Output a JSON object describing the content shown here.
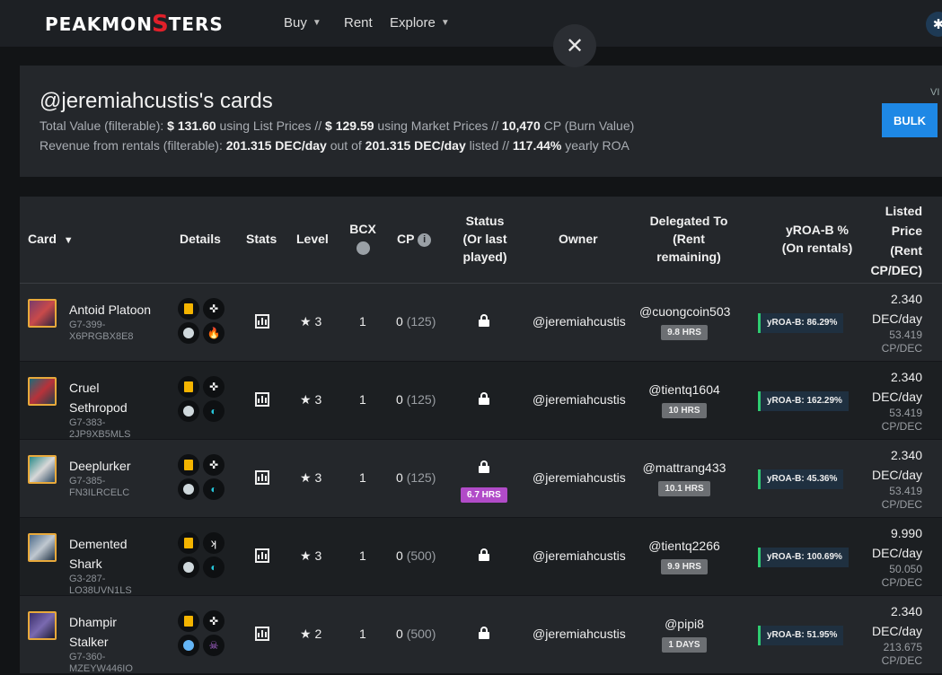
{
  "nav": {
    "logo_pre": "PEAKMON",
    "logo_s": "S",
    "logo_post": "TERS",
    "links": [
      {
        "label": "Buy",
        "has_dropdown": true
      },
      {
        "label": "Rent",
        "has_dropdown": false
      },
      {
        "label": "Explore",
        "has_dropdown": true
      }
    ],
    "close_glyph": "✕",
    "gear_glyph": "✱"
  },
  "summary": {
    "title": "@jeremiahcustis's cards",
    "total_label": "Total Value (filterable):",
    "total_list": "$ 131.60",
    "using_list": "using List Prices //",
    "total_market": "$ 129.59",
    "using_market": "using Market Prices //",
    "total_cp": "10,470",
    "cp_label": "CP (Burn Value)",
    "revenue_label": "Revenue from rentals (filterable):",
    "revenue_rate": "201.315 DEC/day",
    "out_of": "out of",
    "listed_rate": "201.315 DEC/day",
    "listed_label": "listed //",
    "roa": "117.44%",
    "roa_label": "yearly ROA",
    "bulk_label": "BULK",
    "vi_label": "VI"
  },
  "table": {
    "headers": {
      "card": "Card",
      "details": "Details",
      "stats": "Stats",
      "level": "Level",
      "bcx": "BCX",
      "cp": "CP",
      "status1": "Status",
      "status2": "(Or last",
      "status3": "played)",
      "owner": "Owner",
      "deleg1": "Delegated To",
      "deleg2": "(Rent",
      "deleg3": "remaining)",
      "yroa1": "yROA-B %",
      "yroa2": "(On rentals)",
      "price1": "Listed",
      "price2": "Price",
      "price3": "(Rent",
      "price4": "CP/DEC)"
    },
    "star_glyph": "★",
    "info_glyph": "i",
    "rows": [
      {
        "name_l1": "Antoid Platoon",
        "name_l2": "",
        "id1": "G7-399-",
        "id2": "X6PRGBX8E8",
        "level": "3",
        "bcx": "1",
        "cp": "0",
        "cp_max": "(125)",
        "status_badge": "",
        "owner": "@jeremiahcustis",
        "delegated": "@cuongcoin503",
        "remaining": "9.8 HRS",
        "yroa": "yROA-B: 86.29%",
        "price": "2.340",
        "price_unit": "DEC/day",
        "cpdec": "53.419",
        "cpdec_unit": "CP/DEC",
        "element_glyph": "🔥",
        "foil_glyph": "✜",
        "element_color": "#ff5a3c",
        "rarity_color": "#cfd8dc",
        "img_colors": [
          "#7a3b6b",
          "#c94a4a",
          "#2b2540"
        ]
      },
      {
        "name_l1": "Cruel",
        "name_l2": "Sethropod",
        "id1": "G7-383-",
        "id2": "2JP9XB5MLS",
        "level": "3",
        "bcx": "1",
        "cp": "0",
        "cp_max": "(125)",
        "status_badge": "",
        "owner": "@jeremiahcustis",
        "delegated": "@tientq1604",
        "remaining": "10 HRS",
        "yroa": "yROA-B: 162.29%",
        "price": "2.340",
        "price_unit": "DEC/day",
        "cpdec": "53.419",
        "cpdec_unit": "CP/DEC",
        "element_glyph": "◐",
        "foil_glyph": "✜",
        "element_color": "#26c6da",
        "rarity_color": "#cfd8dc",
        "img_colors": [
          "#1f6b78",
          "#b8323a",
          "#23404a"
        ]
      },
      {
        "name_l1": "Deeplurker",
        "name_l2": "",
        "id1": "G7-385-",
        "id2": "FN3ILRCELC",
        "level": "3",
        "bcx": "1",
        "cp": "0",
        "cp_max": "(125)",
        "status_badge": "6.7 HRS",
        "owner": "@jeremiahcustis",
        "delegated": "@mattrang433",
        "remaining": "10.1 HRS",
        "yroa": "yROA-B: 45.36%",
        "price": "2.340",
        "price_unit": "DEC/day",
        "cpdec": "53.419",
        "cpdec_unit": "CP/DEC",
        "element_glyph": "◐",
        "foil_glyph": "✜",
        "element_color": "#26c6da",
        "rarity_color": "#cfd8dc",
        "img_colors": [
          "#2a8b88",
          "#d8d8d8",
          "#2a4660"
        ]
      },
      {
        "name_l1": "Demented",
        "name_l2": "Shark",
        "id1": "G3-287-",
        "id2": "LO38UVN1LS",
        "level": "3",
        "bcx": "1",
        "cp": "0",
        "cp_max": "(500)",
        "status_badge": "",
        "owner": "@jeremiahcustis",
        "delegated": "@tientq2266",
        "remaining": "9.9 HRS",
        "yroa": "yROA-B: 100.69%",
        "price": "9.990",
        "price_unit": "DEC/day",
        "cpdec": "50.050",
        "cpdec_unit": "CP/DEC",
        "element_glyph": "◐",
        "foil_glyph": "ʞ",
        "element_color": "#26c6da",
        "rarity_color": "#cfd8dc",
        "img_colors": [
          "#4c6b8a",
          "#c0c8d0",
          "#1d2f42"
        ]
      },
      {
        "name_l1": "Dhampir",
        "name_l2": "Stalker",
        "id1": "G7-360-",
        "id2": "MZEYW446IO",
        "level": "2",
        "bcx": "1",
        "cp": "0",
        "cp_max": "(500)",
        "status_badge": "",
        "owner": "@jeremiahcustis",
        "delegated": "@pipi8",
        "remaining": "1 DAYS",
        "yroa": "yROA-B: 51.95%",
        "price": "2.340",
        "price_unit": "DEC/day",
        "cpdec": "213.675",
        "cpdec_unit": "CP/DEC",
        "element_glyph": "☠",
        "foil_glyph": "✜",
        "element_color": "#b56ae0",
        "rarity_color": "#64b5f6",
        "img_colors": [
          "#3a2f6a",
          "#7a6ab0",
          "#1c1a30"
        ]
      }
    ]
  }
}
